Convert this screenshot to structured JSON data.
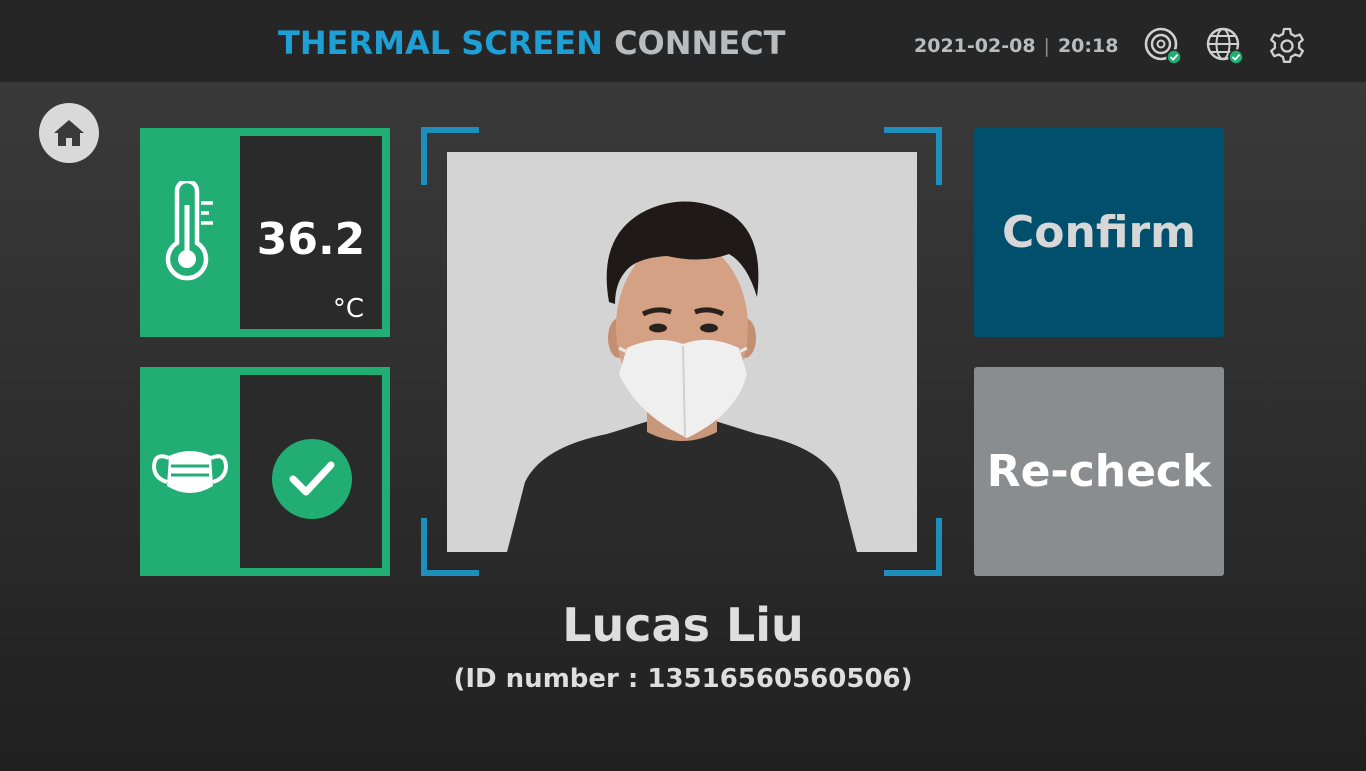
{
  "header": {
    "title_part1": "THERMAL SCREEN",
    "title_part2": "CONNECT",
    "date": "2021-02-08",
    "separator": "|",
    "time": "20:18",
    "icons": [
      "thermal-sensor-connected-icon",
      "network-connected-icon",
      "gear-icon"
    ]
  },
  "home": {
    "icon": "home-icon"
  },
  "temperature": {
    "icon": "thermometer-icon",
    "value": "36.2",
    "unit": "°C"
  },
  "mask": {
    "icon": "face-mask-icon",
    "status_icon": "check-icon",
    "status": "mask detected"
  },
  "buttons": {
    "confirm": "Confirm",
    "recheck": "Re-check"
  },
  "person": {
    "name": "Lucas Liu",
    "id_line": "(ID number : 13516560560506)"
  },
  "colors": {
    "accent_blue": "#1e9fd6",
    "success_green": "#22ad74",
    "confirm_bg": "#004f6c",
    "recheck_bg": "#8a8d90"
  }
}
